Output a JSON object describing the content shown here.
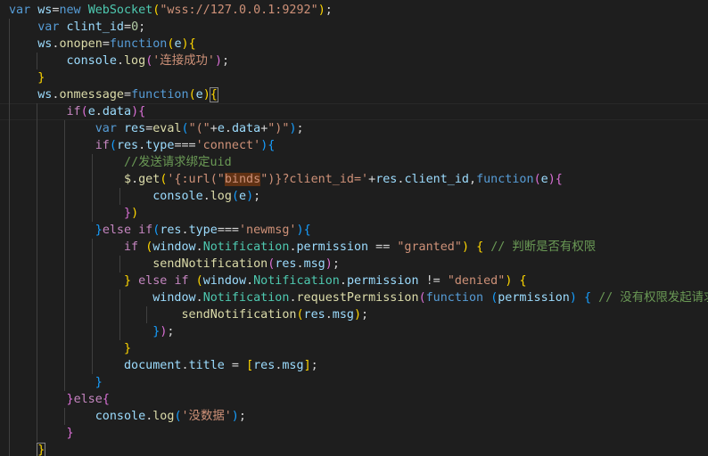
{
  "editor": {
    "title": "Code editor",
    "lines": [
      [
        [
          "kw",
          "var"
        ],
        [
          "op",
          " "
        ],
        [
          "var",
          "ws"
        ],
        [
          "op",
          "="
        ],
        [
          "kw",
          "new"
        ],
        [
          "op",
          " "
        ],
        [
          "cls",
          "WebSocket"
        ],
        [
          "b1",
          "("
        ],
        [
          "str",
          "\"wss://127.0.0.1:9292\""
        ],
        [
          "b1",
          ")"
        ],
        [
          "op",
          ";"
        ]
      ],
      [
        [
          "op",
          "    "
        ],
        [
          "kw",
          "var"
        ],
        [
          "op",
          " "
        ],
        [
          "var",
          "clint_id"
        ],
        [
          "op",
          "="
        ],
        [
          "num",
          "0"
        ],
        [
          "op",
          ";"
        ]
      ],
      [
        [
          "op",
          "    "
        ],
        [
          "var",
          "ws"
        ],
        [
          "op",
          "."
        ],
        [
          "fn",
          "onopen"
        ],
        [
          "op",
          "="
        ],
        [
          "kw",
          "function"
        ],
        [
          "b1",
          "("
        ],
        [
          "var",
          "e"
        ],
        [
          "b1",
          ")"
        ],
        [
          "b1",
          "{"
        ]
      ],
      [
        [
          "op",
          "        "
        ],
        [
          "var",
          "console"
        ],
        [
          "op",
          "."
        ],
        [
          "fn",
          "log"
        ],
        [
          "b2",
          "("
        ],
        [
          "str",
          "'连接成功'"
        ],
        [
          "b2",
          ")"
        ],
        [
          "op",
          ";"
        ]
      ],
      [
        [
          "op",
          "    "
        ],
        [
          "b1",
          "}"
        ]
      ],
      [
        [
          "op",
          "    "
        ],
        [
          "var",
          "ws"
        ],
        [
          "op",
          "."
        ],
        [
          "fn",
          "onmessage"
        ],
        [
          "op",
          "="
        ],
        [
          "kw",
          "function"
        ],
        [
          "b1",
          "("
        ],
        [
          "var",
          "e"
        ],
        [
          "b1",
          ")"
        ],
        [
          "b1bm",
          "{"
        ]
      ],
      [
        [
          "op",
          "        "
        ],
        [
          "ctl",
          "if"
        ],
        [
          "b2",
          "("
        ],
        [
          "var",
          "e"
        ],
        [
          "op",
          "."
        ],
        [
          "var",
          "data"
        ],
        [
          "b2",
          ")"
        ],
        [
          "b2",
          "{"
        ]
      ],
      [
        [
          "op",
          "            "
        ],
        [
          "kw",
          "var"
        ],
        [
          "op",
          " "
        ],
        [
          "var",
          "res"
        ],
        [
          "op",
          "="
        ],
        [
          "fn",
          "eval"
        ],
        [
          "b3",
          "("
        ],
        [
          "str",
          "\"(\""
        ],
        [
          "op",
          "+"
        ],
        [
          "var",
          "e"
        ],
        [
          "op",
          "."
        ],
        [
          "var",
          "data"
        ],
        [
          "op",
          "+"
        ],
        [
          "str",
          "\")\""
        ],
        [
          "b3",
          ")"
        ],
        [
          "op",
          ";"
        ]
      ],
      [
        [
          "op",
          "            "
        ],
        [
          "ctl",
          "if"
        ],
        [
          "b3",
          "("
        ],
        [
          "var",
          "res"
        ],
        [
          "op",
          "."
        ],
        [
          "var",
          "type"
        ],
        [
          "op",
          "==="
        ],
        [
          "str",
          "'connect'"
        ],
        [
          "b3",
          ")"
        ],
        [
          "b3",
          "{"
        ]
      ],
      [
        [
          "op",
          "                "
        ],
        [
          "com",
          "//发送请求绑定uid"
        ]
      ],
      [
        [
          "op",
          "                "
        ],
        [
          "fn",
          "$"
        ],
        [
          "op",
          "."
        ],
        [
          "fn",
          "get"
        ],
        [
          "b1",
          "("
        ],
        [
          "str",
          "'{:url(\""
        ],
        [
          "strhl",
          "binds"
        ],
        [
          "str",
          "\")}?client_id='"
        ],
        [
          "op",
          "+"
        ],
        [
          "var",
          "res"
        ],
        [
          "op",
          "."
        ],
        [
          "var",
          "client_id"
        ],
        [
          "op",
          ","
        ],
        [
          "kw",
          "function"
        ],
        [
          "b2",
          "("
        ],
        [
          "var",
          "e"
        ],
        [
          "b2",
          ")"
        ],
        [
          "b2",
          "{"
        ]
      ],
      [
        [
          "op",
          "                    "
        ],
        [
          "var",
          "console"
        ],
        [
          "op",
          "."
        ],
        [
          "fn",
          "log"
        ],
        [
          "b3",
          "("
        ],
        [
          "var",
          "e"
        ],
        [
          "b3",
          ")"
        ],
        [
          "op",
          ";"
        ]
      ],
      [
        [
          "op",
          "                "
        ],
        [
          "b2",
          "}"
        ],
        [
          "b1",
          ")"
        ]
      ],
      [
        [
          "op",
          "            "
        ],
        [
          "b3",
          "}"
        ],
        [
          "ctl",
          "else"
        ],
        [
          "op",
          " "
        ],
        [
          "ctl",
          "if"
        ],
        [
          "b3",
          "("
        ],
        [
          "var",
          "res"
        ],
        [
          "op",
          "."
        ],
        [
          "var",
          "type"
        ],
        [
          "op",
          "==="
        ],
        [
          "str",
          "'newmsg'"
        ],
        [
          "b3",
          ")"
        ],
        [
          "b3",
          "{"
        ]
      ],
      [
        [
          "op",
          "                "
        ],
        [
          "ctl",
          "if"
        ],
        [
          "op",
          " "
        ],
        [
          "b1",
          "("
        ],
        [
          "var",
          "window"
        ],
        [
          "op",
          "."
        ],
        [
          "cls",
          "Notification"
        ],
        [
          "op",
          "."
        ],
        [
          "var",
          "permission"
        ],
        [
          "op",
          " == "
        ],
        [
          "str",
          "\"granted\""
        ],
        [
          "b1",
          ")"
        ],
        [
          "op",
          " "
        ],
        [
          "b1",
          "{"
        ],
        [
          "op",
          " "
        ],
        [
          "com",
          "// 判断是否有权限"
        ]
      ],
      [
        [
          "op",
          "                    "
        ],
        [
          "fn",
          "sendNotification"
        ],
        [
          "b2",
          "("
        ],
        [
          "var",
          "res"
        ],
        [
          "op",
          "."
        ],
        [
          "var",
          "msg"
        ],
        [
          "b2",
          ")"
        ],
        [
          "op",
          ";"
        ]
      ],
      [
        [
          "op",
          "                "
        ],
        [
          "b1",
          "}"
        ],
        [
          "op",
          " "
        ],
        [
          "ctl",
          "else"
        ],
        [
          "op",
          " "
        ],
        [
          "ctl",
          "if"
        ],
        [
          "op",
          " "
        ],
        [
          "b1",
          "("
        ],
        [
          "var",
          "window"
        ],
        [
          "op",
          "."
        ],
        [
          "cls",
          "Notification"
        ],
        [
          "op",
          "."
        ],
        [
          "var",
          "permission"
        ],
        [
          "op",
          " != "
        ],
        [
          "str",
          "\"denied\""
        ],
        [
          "b1",
          ")"
        ],
        [
          "op",
          " "
        ],
        [
          "b1",
          "{"
        ]
      ],
      [
        [
          "op",
          "                    "
        ],
        [
          "var",
          "window"
        ],
        [
          "op",
          "."
        ],
        [
          "cls",
          "Notification"
        ],
        [
          "op",
          "."
        ],
        [
          "fn",
          "requestPermission"
        ],
        [
          "b2",
          "("
        ],
        [
          "kw",
          "function"
        ],
        [
          "op",
          " "
        ],
        [
          "b3",
          "("
        ],
        [
          "var",
          "permission"
        ],
        [
          "b3",
          ")"
        ],
        [
          "op",
          " "
        ],
        [
          "b3",
          "{"
        ],
        [
          "op",
          " "
        ],
        [
          "com",
          "// 没有权限发起请求"
        ]
      ],
      [
        [
          "op",
          "                        "
        ],
        [
          "fn",
          "sendNotification"
        ],
        [
          "b1",
          "("
        ],
        [
          "var",
          "res"
        ],
        [
          "op",
          "."
        ],
        [
          "var",
          "msg"
        ],
        [
          "b1",
          ")"
        ],
        [
          "op",
          ";"
        ]
      ],
      [
        [
          "op",
          "                    "
        ],
        [
          "b3",
          "}"
        ],
        [
          "b2",
          ")"
        ],
        [
          "op",
          ";"
        ]
      ],
      [
        [
          "op",
          "                "
        ],
        [
          "b1",
          "}"
        ]
      ],
      [
        [
          "op",
          "                "
        ],
        [
          "var",
          "document"
        ],
        [
          "op",
          "."
        ],
        [
          "var",
          "title"
        ],
        [
          "op",
          " = "
        ],
        [
          "b1",
          "["
        ],
        [
          "var",
          "res"
        ],
        [
          "op",
          "."
        ],
        [
          "var",
          "msg"
        ],
        [
          "b1",
          "]"
        ],
        [
          "op",
          ";"
        ]
      ],
      [
        [
          "op",
          "            "
        ],
        [
          "b3",
          "}"
        ]
      ],
      [
        [
          "op",
          "        "
        ],
        [
          "b2",
          "}"
        ],
        [
          "ctl",
          "else"
        ],
        [
          "b2",
          "{"
        ]
      ],
      [
        [
          "op",
          "            "
        ],
        [
          "var",
          "console"
        ],
        [
          "op",
          "."
        ],
        [
          "fn",
          "log"
        ],
        [
          "b3",
          "("
        ],
        [
          "str",
          "'没数据'"
        ],
        [
          "b3",
          ")"
        ],
        [
          "op",
          ";"
        ]
      ],
      [
        [
          "op",
          "        "
        ],
        [
          "b2",
          "}"
        ]
      ],
      [
        [
          "op",
          "    "
        ],
        [
          "b1bm",
          "}"
        ]
      ]
    ]
  }
}
